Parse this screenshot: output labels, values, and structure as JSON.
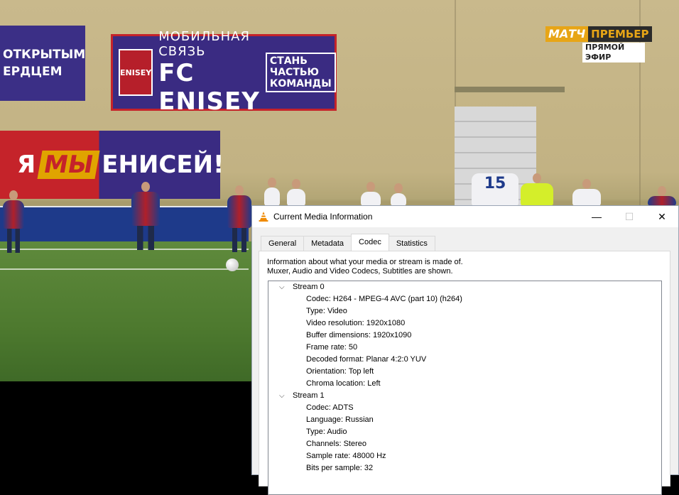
{
  "video": {
    "banners": {
      "left_line1": "ОТКРЫТЫМ",
      "left_line2": "ЕРДЦЕМ",
      "main_line1": "МОБИЛЬНАЯ СВЯЗЬ",
      "main_line2": "FC ENISEY",
      "main_logo": "ENISEY",
      "side_line1": "СТАНЬ",
      "side_line2": "ЧАСТЬЮ",
      "side_line3": "КОМАНДЫ",
      "slogan_part1": "Я",
      "slogan_part2": "МЫ",
      "slogan_part3": "ЕНИСЕЙ!"
    },
    "player_number": "15",
    "channel": {
      "logo_left": "МАТЧ",
      "logo_right": "ПРЕМЬЕР",
      "live_label": "ПРЯМОЙ ЭФИР"
    }
  },
  "dialog": {
    "title": "Current Media Information",
    "controls": {
      "minimize": "—",
      "maximize": "☐",
      "close": "✕"
    },
    "tabs": [
      {
        "label": "General",
        "active": false
      },
      {
        "label": "Metadata",
        "active": false
      },
      {
        "label": "Codec",
        "active": true
      },
      {
        "label": "Statistics",
        "active": false
      }
    ],
    "description_line1": "Information about what your media or stream is made of.",
    "description_line2": "Muxer, Audio and Video Codecs, Subtitles are shown.",
    "streams": [
      {
        "label": "Stream 0",
        "items": [
          "Codec: H264 - MPEG-4 AVC (part 10) (h264)",
          "Type: Video",
          "Video resolution: 1920x1080",
          "Buffer dimensions: 1920x1090",
          "Frame rate: 50",
          "Decoded format: Planar 4:2:0 YUV",
          "Orientation: Top left",
          "Chroma location: Left"
        ]
      },
      {
        "label": "Stream 1",
        "items": [
          "Codec: ADTS",
          "Language: Russian",
          "Type: Audio",
          "Channels: Stereo",
          "Sample rate: 48000 Hz",
          "Bits per sample: 32"
        ]
      }
    ]
  }
}
